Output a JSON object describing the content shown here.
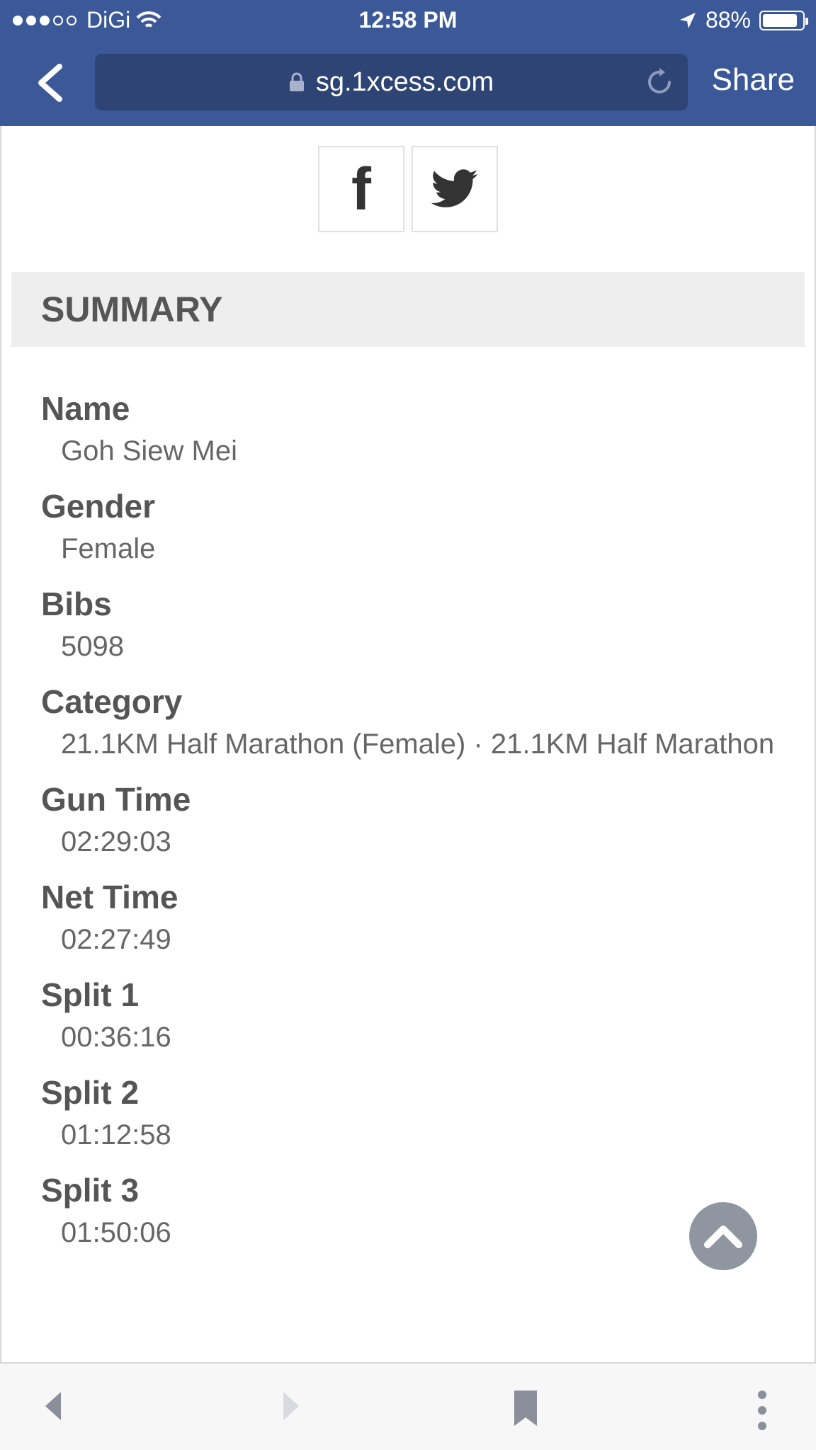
{
  "status_bar": {
    "carrier": "DiGi",
    "time": "12:58 PM",
    "battery": "88%",
    "signal_bars": 3
  },
  "browser": {
    "url": "sg.1xcess.com",
    "share_label": "Share",
    "icons": {
      "back": "chevron-left-icon",
      "lock": "lock-icon",
      "reload": "reload-icon"
    }
  },
  "social": {
    "facebook": "f"
  },
  "summary": {
    "title": "SUMMARY",
    "fields": [
      {
        "label": "Name",
        "value": "Goh Siew Mei"
      },
      {
        "label": "Gender",
        "value": "Female"
      },
      {
        "label": "Bibs",
        "value": "5098"
      },
      {
        "label": "Category",
        "value": "21.1KM Half Marathon (Female) · 21.1KM Half Marathon"
      },
      {
        "label": "Gun Time",
        "value": "02:29:03"
      },
      {
        "label": "Net Time",
        "value": "02:27:49"
      },
      {
        "label": "Split 1",
        "value": "00:36:16"
      },
      {
        "label": "Split 2",
        "value": "01:12:58"
      },
      {
        "label": "Split 3",
        "value": "01:50:06"
      }
    ]
  },
  "colors": {
    "brand": "#3b5998",
    "url_bar": "#2e4474",
    "scroll_top_button": "#8f96a0"
  }
}
